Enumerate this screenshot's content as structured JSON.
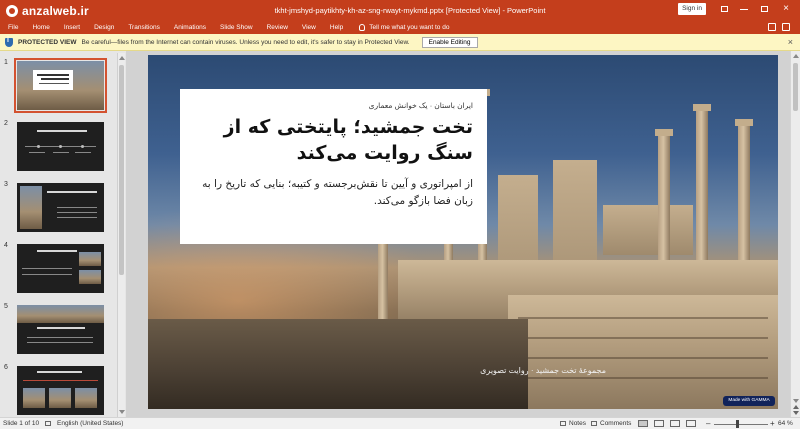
{
  "titlebar": {
    "watermark": "anzalweb.ir",
    "doc_title": "tkht-jmshyd-paytikhty-kh-az-sng-rwayt-mykmd.pptx [Protected View]",
    "app_name": "PowerPoint",
    "sign_in": "Sign in",
    "accent": "#c43e1c"
  },
  "ribbon": {
    "tabs": [
      "File",
      "Home",
      "Insert",
      "Design",
      "Transitions",
      "Animations",
      "Slide Show",
      "Review",
      "View",
      "Help"
    ],
    "tell_me": "Tell me what you want to do"
  },
  "protected_view": {
    "label": "PROTECTED VIEW",
    "message": "Be careful—files from the Internet can contain viruses. Unless you need to edit, it's safer to stay in Protected View.",
    "button": "Enable Editing"
  },
  "thumbnails": [
    {
      "number": "1",
      "selected": true
    },
    {
      "number": "2",
      "selected": false
    },
    {
      "number": "3",
      "selected": false
    },
    {
      "number": "4",
      "selected": false
    },
    {
      "number": "5",
      "selected": false
    },
    {
      "number": "6",
      "selected": false
    }
  ],
  "slide": {
    "kicker": "ایران باستان · یک خوانش معماری",
    "headline": "تخت جمشید؛ پایتختی که از سنگ روایت می‌کند",
    "subtitle": "از امپراتوری و آیین تا نقش‌برجسته و کتیبه؛ بنایی که تاریخ را به زبان فضا بازگو می‌کند.",
    "caption": "مجموعهٔ تخت جمشید · روایت تصویری",
    "badge": "Made with GAMMA"
  },
  "statusbar": {
    "slide_count": "Slide 1 of 10",
    "language": "English (United States)",
    "notes": "Notes",
    "comments": "Comments",
    "zoom": "64 %"
  }
}
